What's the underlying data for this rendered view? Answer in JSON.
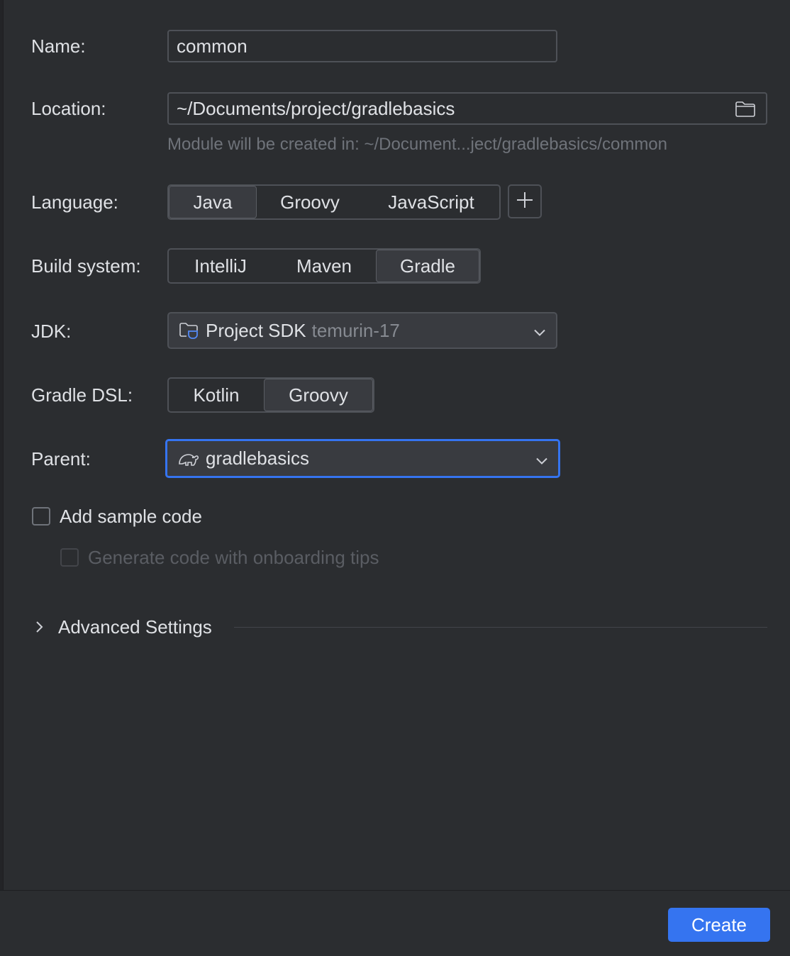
{
  "form": {
    "name_label": "Name:",
    "name_value": "common",
    "location_label": "Location:",
    "location_value": "~/Documents/project/gradlebasics",
    "location_hint": "Module will be created in: ~/Document...ject/gradlebasics/common",
    "language_label": "Language:",
    "language_options": [
      "Java",
      "Groovy",
      "JavaScript"
    ],
    "language_selected": "Java",
    "build_label": "Build system:",
    "build_options": [
      "IntelliJ",
      "Maven",
      "Gradle"
    ],
    "build_selected": "Gradle",
    "jdk_label": "JDK:",
    "jdk_value": "Project SDK",
    "jdk_version": "temurin-17",
    "dsl_label": "Gradle DSL:",
    "dsl_options": [
      "Kotlin",
      "Groovy"
    ],
    "dsl_selected": "Groovy",
    "parent_label": "Parent:",
    "parent_value": "gradlebasics",
    "sample_code_label": "Add sample code",
    "onboarding_label": "Generate code with onboarding tips",
    "advanced_label": "Advanced Settings"
  },
  "footer": {
    "create_label": "Create"
  },
  "colors": {
    "background": "#2b2d30",
    "accent": "#3574f0",
    "text": "#dfe1e5",
    "muted": "#6f737a"
  }
}
